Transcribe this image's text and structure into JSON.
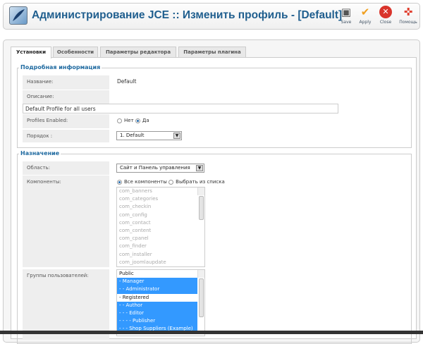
{
  "header": {
    "title": "Администрирование JCE :: Изменить профиль - [Default]",
    "toolbar": [
      {
        "label": "Save",
        "icon": "save-icon"
      },
      {
        "label": "Apply",
        "icon": "check-icon"
      },
      {
        "label": "Close",
        "icon": "close-icon"
      },
      {
        "label": "Помощь",
        "icon": "help-icon"
      }
    ]
  },
  "tabs": [
    "Установки",
    "Особенности",
    "Параметры редактора",
    "Параметры плагина"
  ],
  "details": {
    "legend": "Подробная информация",
    "name_label": "Название:",
    "name_value": "Default",
    "desc_label": "Описание:",
    "desc_value": "Default Profile for all users",
    "enabled_label": "Profiles Enabled:",
    "enabled_no": "Нет",
    "enabled_yes": "Да",
    "enabled": "Да",
    "order_label": "Порядок :",
    "order_value": "1. Default"
  },
  "assignment": {
    "legend": "Назначение",
    "area_label": "Область:",
    "area_value": "Сайт и Панель управления",
    "components_label": "Компоненты:",
    "all_components": "Все компоненты",
    "select_from_list": "Выбрать из списка",
    "components": [
      "com_banners",
      "com_categories",
      "com_checkin",
      "com_config",
      "com_contact",
      "com_content",
      "com_cpanel",
      "com_finder",
      "com_installer",
      "com_joomlaupdate"
    ],
    "groups_label": "Группы пользователей:",
    "groups": [
      {
        "label": "Public",
        "selected": false
      },
      {
        "label": "- Manager",
        "selected": true
      },
      {
        "label": "- - Administrator",
        "selected": true
      },
      {
        "label": "- Registered",
        "selected": false
      },
      {
        "label": "- - Author",
        "selected": true
      },
      {
        "label": "- - - Editor",
        "selected": true
      },
      {
        "label": "- - - - Publisher",
        "selected": true
      },
      {
        "label": "- - - Shop Suppliers (Example)",
        "selected": true
      }
    ]
  }
}
